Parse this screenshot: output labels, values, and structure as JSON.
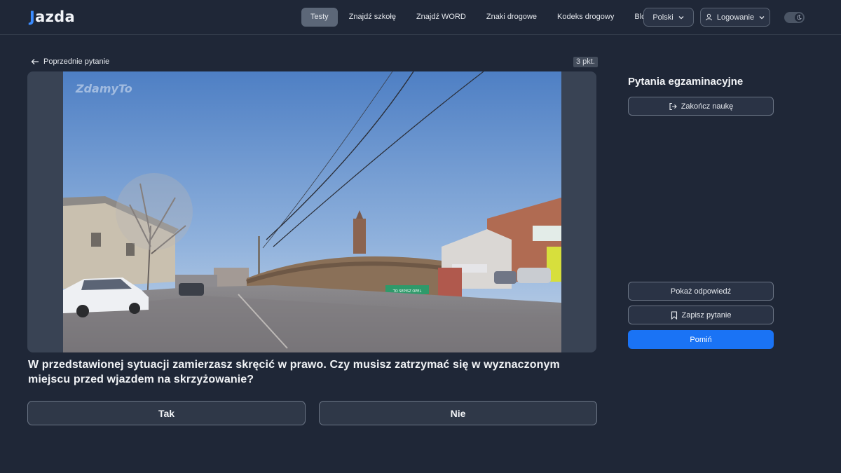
{
  "header": {
    "logo": {
      "mark": "J",
      "text": "azda"
    },
    "nav": [
      {
        "label": "Testy",
        "active": true
      },
      {
        "label": "Znajdź szkołę",
        "active": false
      },
      {
        "label": "Znajdź WORD",
        "active": false
      },
      {
        "label": "Znaki drogowe",
        "active": false
      },
      {
        "label": "Kodeks drogowy",
        "active": false
      },
      {
        "label": "Blog",
        "active": false
      }
    ],
    "language": {
      "label": "Polski",
      "icon": "chevron-down-icon"
    },
    "login": {
      "label": "Logowanie",
      "icon": "user-icon"
    },
    "theme_toggle": {
      "icon": "moon-icon"
    }
  },
  "main": {
    "back_label": "Poprzednie pytanie",
    "points": "3 pkt.",
    "media": {
      "watermark": "ZdamyTo",
      "billboard_text": "TO SEPISZ OPEL"
    },
    "question": "W przedstawionej sytuacji zamierzasz skręcić w prawo. Czy musisz zatrzymać się w wyznaczonym miejscu przed wjazdem na skrzyżowanie?",
    "answers": [
      {
        "label": "Tak"
      },
      {
        "label": "Nie"
      }
    ]
  },
  "sidebar": {
    "title": "Pytania egzaminacyjne",
    "finish_label": "Zakończ naukę",
    "show_answer_label": "Pokaż odpowiedź",
    "save_label": "Zapisz pytanie",
    "skip_label": "Pomiń"
  },
  "colors": {
    "background": "#1f2737",
    "accent": "#1a73f5",
    "logo_mark": "#3b8cff"
  }
}
